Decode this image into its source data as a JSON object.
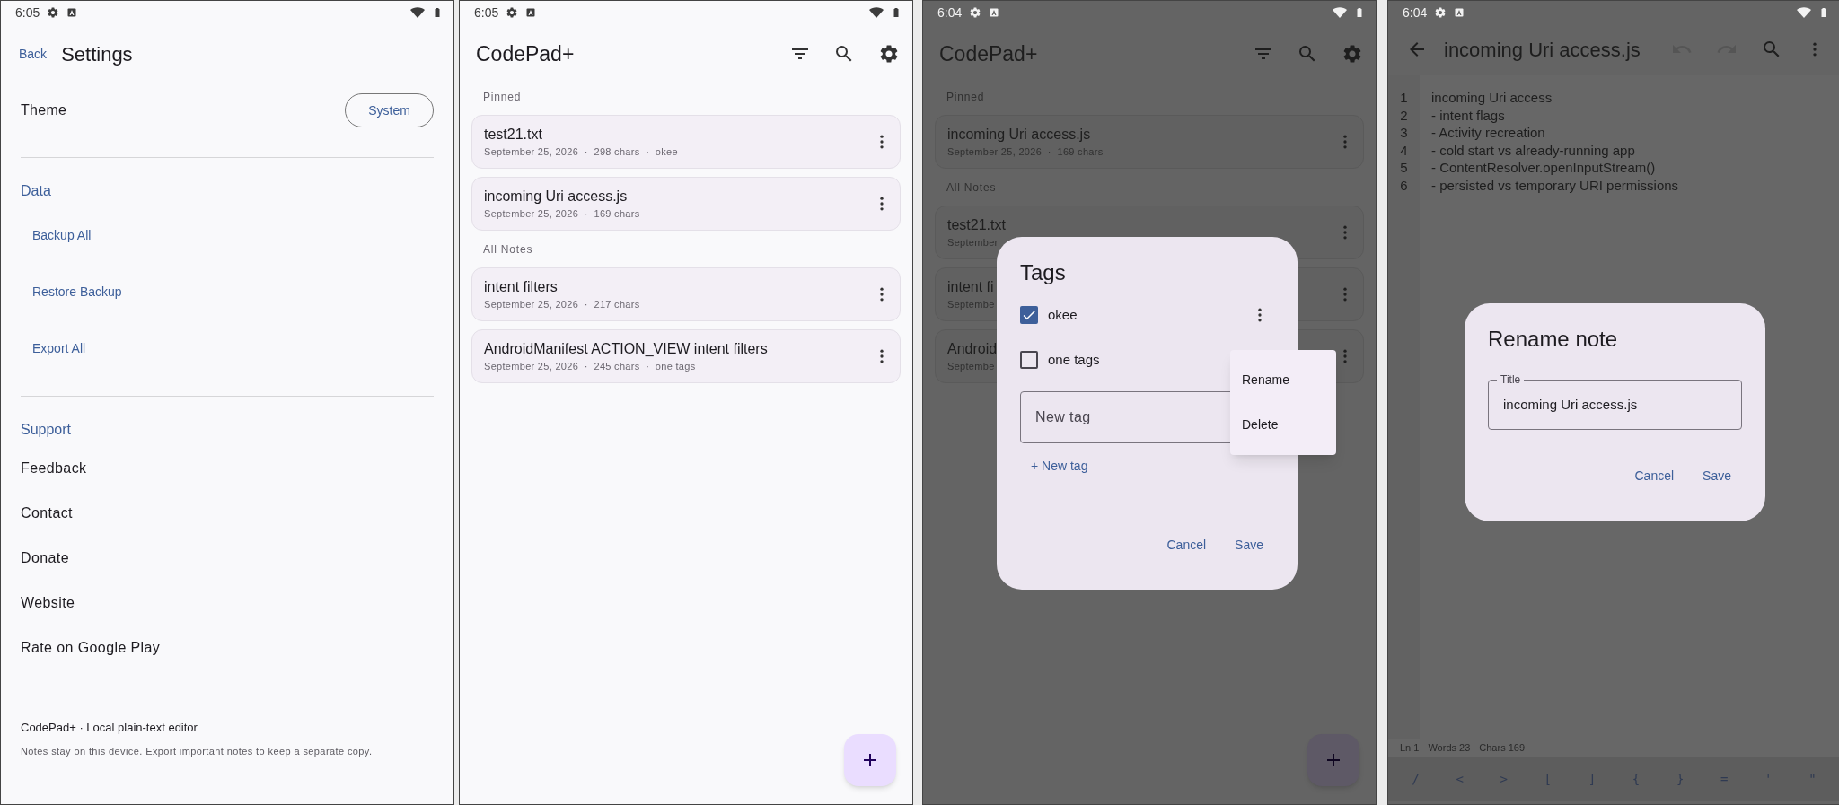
{
  "settings_screen": {
    "status_bar": {
      "time": "6:05"
    },
    "back_link": "Back",
    "title": "Settings",
    "theme": {
      "label": "Theme",
      "value": "System"
    },
    "sections": [
      {
        "title": "Data",
        "kind": "actions",
        "items": [
          "Backup All",
          "Restore Backup",
          "Export All"
        ]
      },
      {
        "title": "Support",
        "kind": "links",
        "items": [
          "Feedback",
          "Contact",
          "Donate",
          "Website",
          "Rate on Google Play"
        ]
      }
    ],
    "footer": {
      "title": "CodePad+ · Local plain-text editor",
      "note": "Notes stay on this device. Export important notes to keep a separate copy."
    }
  },
  "notes_screen": {
    "status_bar": {
      "time": "6:05"
    },
    "dimmed": false,
    "title": "CodePad+",
    "groups": [
      {
        "title": "Pinned",
        "notes": [
          {
            "title": "test21.txt",
            "meta": "September 25, 2026  ·  298 chars  ·  okee"
          },
          {
            "title": "incoming Uri access.js",
            "meta": "September 25, 2026  ·  169 chars"
          }
        ]
      },
      {
        "title": "All Notes",
        "notes": [
          {
            "title": "intent filters",
            "meta": "September 25, 2026  ·  217 chars"
          },
          {
            "title": "AndroidManifest ACTION_VIEW intent filters",
            "meta": "September 25, 2026  ·  245 chars  ·  one tags"
          }
        ]
      }
    ]
  },
  "tags_screen": {
    "status_bar": {
      "time": "6:04"
    },
    "dimmed": true,
    "title": "CodePad+",
    "groups": [
      {
        "title": "Pinned",
        "notes": [
          {
            "title": "incoming Uri access.js",
            "meta": "September 25, 2026  ·  169 chars"
          }
        ]
      },
      {
        "title": "All Notes",
        "notes": [
          {
            "title": "test21.txt",
            "meta": "September"
          },
          {
            "title": "intent fi",
            "meta": "Septembe"
          },
          {
            "title": "Android",
            "meta": "Septembe"
          }
        ]
      }
    ],
    "dialog": {
      "title": "Tags",
      "tags": [
        {
          "label": "okee",
          "checked": true,
          "menu_open": true
        },
        {
          "label": "one tags",
          "checked": false,
          "menu_open": false
        }
      ],
      "new_tag_placeholder": "New tag",
      "add_button": "+ New tag",
      "buttons": [
        "Cancel",
        "Save"
      ]
    },
    "menu": {
      "items": [
        "Rename",
        "Delete"
      ]
    }
  },
  "editor_screen": {
    "status_bar": {
      "time": "6:04"
    },
    "dimmed": true,
    "title": "incoming Uri access.js",
    "lines": [
      {
        "number": "1",
        "text": "incoming Uri access"
      },
      {
        "number": "2",
        "text": "- intent flags"
      },
      {
        "number": "3",
        "text": "- Activity recreation"
      },
      {
        "number": "4",
        "text": "- cold start vs already-running app"
      },
      {
        "number": "5",
        "text": "- ContentResolver.openInputStream()"
      },
      {
        "number": "6",
        "text": "- persisted vs temporary URI permissions"
      }
    ],
    "stats": [
      "Ln 1",
      "Words 23",
      "Chars 169"
    ],
    "keys": [
      "/",
      "<",
      ">",
      "[",
      "]",
      "{",
      "}",
      "=",
      "'",
      "\""
    ],
    "dialog": {
      "title": "Rename note",
      "field_label": "Title",
      "value": "incoming Uri access.js",
      "buttons": [
        "Cancel",
        "Save"
      ]
    }
  }
}
